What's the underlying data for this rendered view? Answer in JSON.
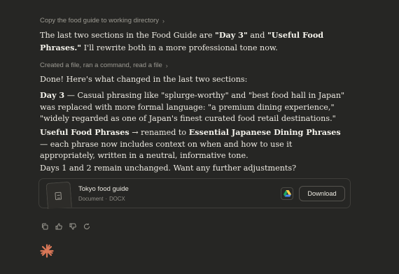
{
  "steps": {
    "copy_label": "Copy the food guide to working directory",
    "edit_label": "Created a file, ran a command, read a file"
  },
  "intro": {
    "before": "The last two sections in the Food Guide are ",
    "section1": "\"Day 3\"",
    "and": " and ",
    "section2": "\"Useful Food Phrases.\"",
    "after": " I'll rewrite both in a more professional tone now."
  },
  "summary_heading": "Done! Here's what changed in the last two sections:",
  "day3": {
    "label": "Day 3",
    "text": " — Casual phrasing like \"splurge-worthy\" and \"best food hall in Japan\" was replaced with more formal language: \"a premium dining experience,\" \"widely regarded as one of Japan's finest curated food retail destinations.\""
  },
  "phrases": {
    "label": "Useful Food Phrases",
    "arrow": " → renamed to ",
    "new_label": "Essential Japanese Dining Phrases",
    "text": " — each phrase now includes context on when and how to use it appropriately, written in a neutral, informative tone."
  },
  "closing": "Days 1 and 2 remain unchanged. Want any further adjustments?",
  "file_card": {
    "name": "Tokyo food guide",
    "type": "Document",
    "separator": "·",
    "format": "DOCX",
    "gdrive_icon": "google-drive-icon",
    "download_label": "Download"
  },
  "actions": [
    "copy-icon",
    "thumbs-up-icon",
    "thumbs-down-icon",
    "retry-icon"
  ],
  "colors": {
    "background": "#262624",
    "text": "#ece9e1",
    "muted": "#9c9a92",
    "accent": "#d97757"
  }
}
